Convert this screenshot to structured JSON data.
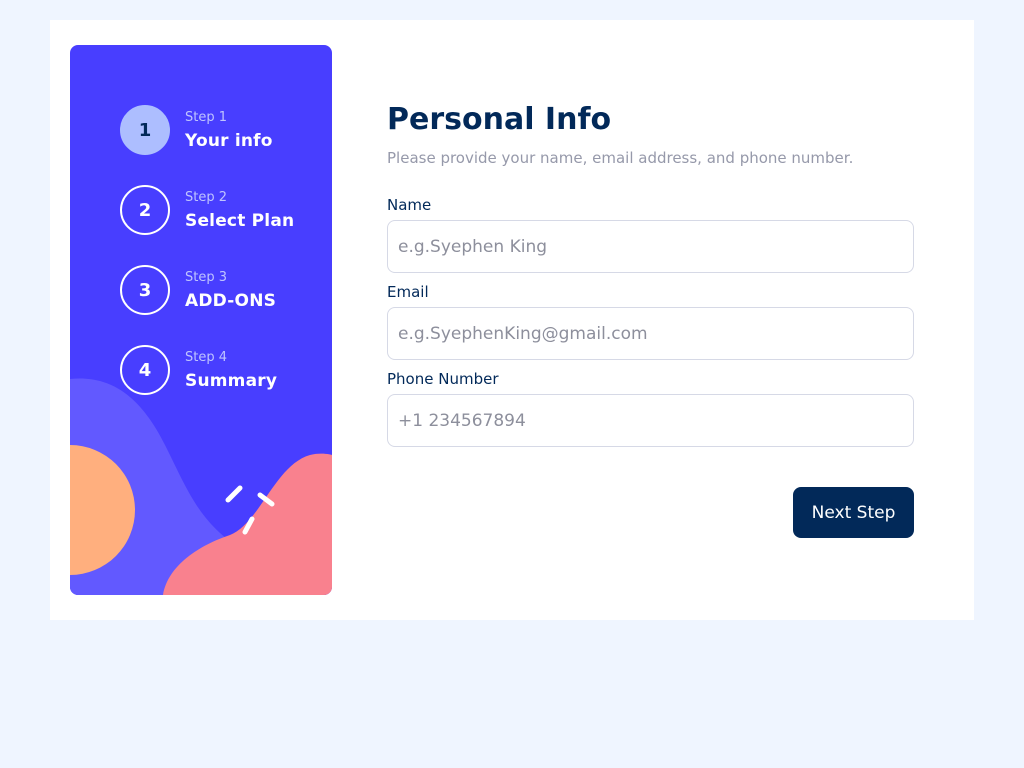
{
  "steps": [
    {
      "kicker": "Step 1",
      "number": "1",
      "title": "Your info",
      "active": true
    },
    {
      "kicker": "Step 2",
      "number": "2",
      "title": "Select Plan",
      "active": false
    },
    {
      "kicker": "Step 3",
      "number": "3",
      "title": "ADD-ONS",
      "active": false
    },
    {
      "kicker": "Step 4",
      "number": "4",
      "title": "Summary",
      "active": false
    }
  ],
  "form": {
    "title": "Personal Info",
    "subtitle": "Please provide your name, email address, and phone number.",
    "name": {
      "label": "Name",
      "placeholder": "e.g.Syephen King",
      "value": ""
    },
    "email": {
      "label": "Email",
      "placeholder": "e.g.SyephenKing@gmail.com",
      "value": ""
    },
    "phone": {
      "label": "Phone Number",
      "placeholder": "+1 234567894",
      "value": ""
    },
    "next_label": "Next Step"
  },
  "colors": {
    "page_background": "#eff5ff",
    "sidebar": "#483eff",
    "active_step": "#adbeff",
    "heading": "#022959",
    "button": "#022959",
    "blob_blue": "#6259ff",
    "blob_orange": "#ffaf7e",
    "blob_pink": "#f9818e"
  }
}
